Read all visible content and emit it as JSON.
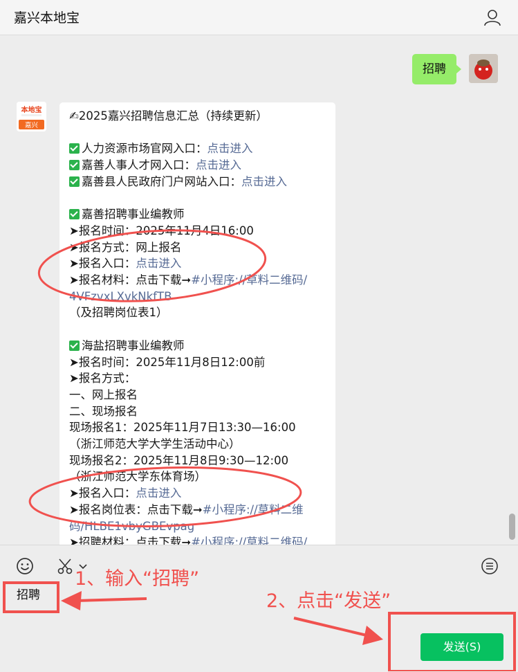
{
  "window": {
    "title": "嘉兴本地宝"
  },
  "chat": {
    "sent_message": "招聘",
    "article": {
      "title": "✍2025嘉兴招聘信息汇总（持续更新）",
      "portals": [
        {
          "label": "人力资源市场官网入口：",
          "link": "点击进入"
        },
        {
          "label": "嘉善人事人才网入口：",
          "link": "点击进入"
        },
        {
          "label": "嘉善县人民政府门户网站入口：",
          "link": "点击进入"
        }
      ],
      "jiashan": {
        "heading": "嘉善招聘事业编教师",
        "time": "➤报名时间：2025年11月4日16:00",
        "method": "➤报名方式：网上报名",
        "entry_label": "➤报名入口：",
        "entry_link": "点击进入",
        "material_label": "➤报名材料：点击下载➞",
        "material_link_1": "#小程序://草料二维码/",
        "material_link_2": "4VFzvxLXvkNkfTB",
        "material_note": "（及招聘岗位表1）"
      },
      "haiyan": {
        "heading": "海盐招聘事业编教师",
        "time": "➤报名时间：2025年11月8日12:00前",
        "method": "➤报名方式：",
        "m1": "一、网上报名",
        "m2": "二、现场报名",
        "site1": "现场报名1：2025年11月7日13:30—16:00",
        "site1_place": "（浙江师范大学大学生活动中心）",
        "site2": "现场报名2：2025年11月8日9:30—12:00",
        "site2_place": "（浙江师范大学东体育场）",
        "entry_label": "➤报名入口：",
        "entry_link": "点击进入",
        "posts_label": "➤报名岗位表：点击下载➞",
        "posts_link_1": "#小程序://草料二维",
        "posts_link_2": "码/HLBE1vbyGBEvpag",
        "material_label": "➤招聘材料：点击下载➞",
        "material_link": "#小程序://草料二维码/"
      }
    }
  },
  "input": {
    "text": "招聘"
  },
  "send_button": {
    "label": "发送(S)"
  },
  "annotations": {
    "step1": "1、输入“招聘”",
    "step2": "2、点击“发送”"
  },
  "colors": {
    "accent_green": "#07c160",
    "bubble_green": "#95ec69",
    "link": "#576b95",
    "annotation_red": "#f0514e"
  }
}
